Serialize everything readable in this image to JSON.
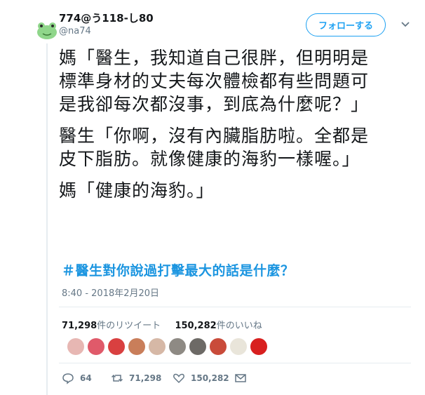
{
  "user": {
    "display_name": "774@う118-し80",
    "screen_name": "@na74",
    "avatar_icon": "green-frog-avatar-icon"
  },
  "follow_label": "フォローする",
  "tweet": {
    "paragraphs": [
      "媽「醫生，我知道自己很胖，但明明是標準身材的丈夫每次體檢都有些問題可是我卻每次都沒事，到底為什麼呢？」",
      "醫生「你啊，沒有內臟脂肪啦。全都是皮下脂肪。就像健康的海豹一樣喔。」",
      "媽「健康的海豹。」"
    ],
    "hashtag": "＃醫生對你說過打擊最大的話是什麼？",
    "timestamp": "8:40 - 2018年2月20日"
  },
  "stats": {
    "retweets_count": "71,298",
    "retweets_label": "件のリツイート",
    "likes_count": "150,282",
    "likes_label": "件のいいね"
  },
  "liker_avatars": [
    {
      "name": "liker-avatar-1",
      "color": "#e7b7b3"
    },
    {
      "name": "liker-avatar-2",
      "color": "#e05a6a"
    },
    {
      "name": "liker-avatar-3",
      "color": "#d94040"
    },
    {
      "name": "liker-avatar-4",
      "color": "#c97e5a"
    },
    {
      "name": "liker-avatar-5",
      "color": "#d6b8a6"
    },
    {
      "name": "liker-avatar-6",
      "color": "#8e8a84"
    },
    {
      "name": "liker-avatar-7",
      "color": "#6d6a66"
    },
    {
      "name": "liker-avatar-8",
      "color": "#c94b3a"
    },
    {
      "name": "liker-avatar-9",
      "color": "#e9e5da"
    },
    {
      "name": "liker-avatar-10",
      "color": "#d8201f"
    }
  ],
  "actions": {
    "reply_count": "64",
    "retweet_count": "71,298",
    "like_count": "150,282"
  },
  "colors": {
    "accent": "#1da1f2",
    "hashtag": "#1b95e0",
    "secondary_text": "#657786",
    "divider": "#e6ecf0"
  }
}
